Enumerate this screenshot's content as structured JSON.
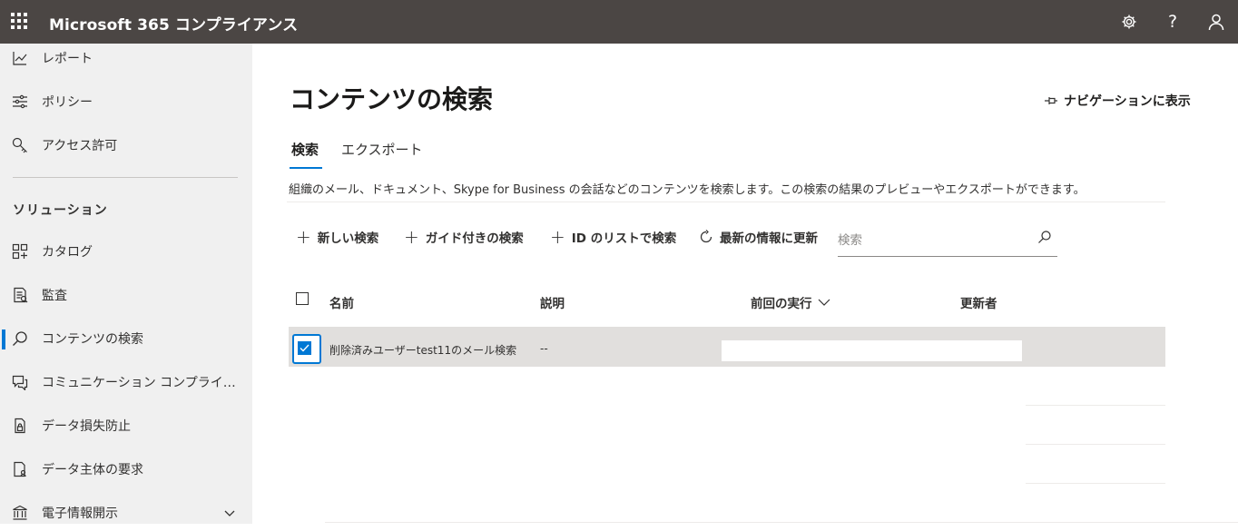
{
  "topbar": {
    "app_title": "Microsoft 365 コンプライアンス",
    "icons": [
      "waffle-icon",
      "settings-icon",
      "help-icon",
      "account-icon"
    ],
    "help_glyph": "?"
  },
  "sidebar": {
    "items_top": [
      {
        "label": "レポート",
        "icon": "report-icon"
      },
      {
        "label": "ポリシー",
        "icon": "policy-icon"
      },
      {
        "label": "アクセス許可",
        "icon": "permissions-icon"
      }
    ],
    "section_title": "ソリューション",
    "items": [
      {
        "label": "カタログ",
        "icon": "catalog-icon"
      },
      {
        "label": "監査",
        "icon": "audit-icon"
      },
      {
        "label": "コンテンツの検索",
        "icon": "search-icon",
        "active": true
      },
      {
        "label": "コミュニケーション コンプライ…",
        "icon": "communication-icon"
      },
      {
        "label": "データ損失防止",
        "icon": "dlp-icon"
      },
      {
        "label": "データ主体の要求",
        "icon": "dsr-icon"
      },
      {
        "label": "電子情報開示",
        "icon": "ediscovery-icon",
        "expandable": true
      }
    ],
    "accent_color": "#0078d4"
  },
  "main": {
    "page_title": "コンテンツの検索",
    "show_in_nav": "ナビゲーションに表示",
    "tabs": [
      {
        "label": "検索",
        "selected": true
      },
      {
        "label": "エクスポート",
        "selected": false
      }
    ],
    "description": "組織のメール、ドキュメント、Skype for Business の会話などのコンテンツを検索します。この検索の結果のプレビューやエクスポートができます。",
    "toolbar": {
      "new_search": "新しい検索",
      "guided_search": "ガイド付きの検索",
      "id_list_search": "ID のリストで検索",
      "refresh": "最新の情報に更新",
      "search_placeholder": "検索"
    },
    "table": {
      "columns": [
        "名前",
        "説明",
        "前回の実行",
        "更新者"
      ],
      "sort_indicator": "chevron-down-icon",
      "rows": [
        {
          "name": "削除済みユーザーtest11のメール検索",
          "description": "--",
          "last_run": "",
          "modified_by": "",
          "selected": true
        }
      ]
    }
  }
}
